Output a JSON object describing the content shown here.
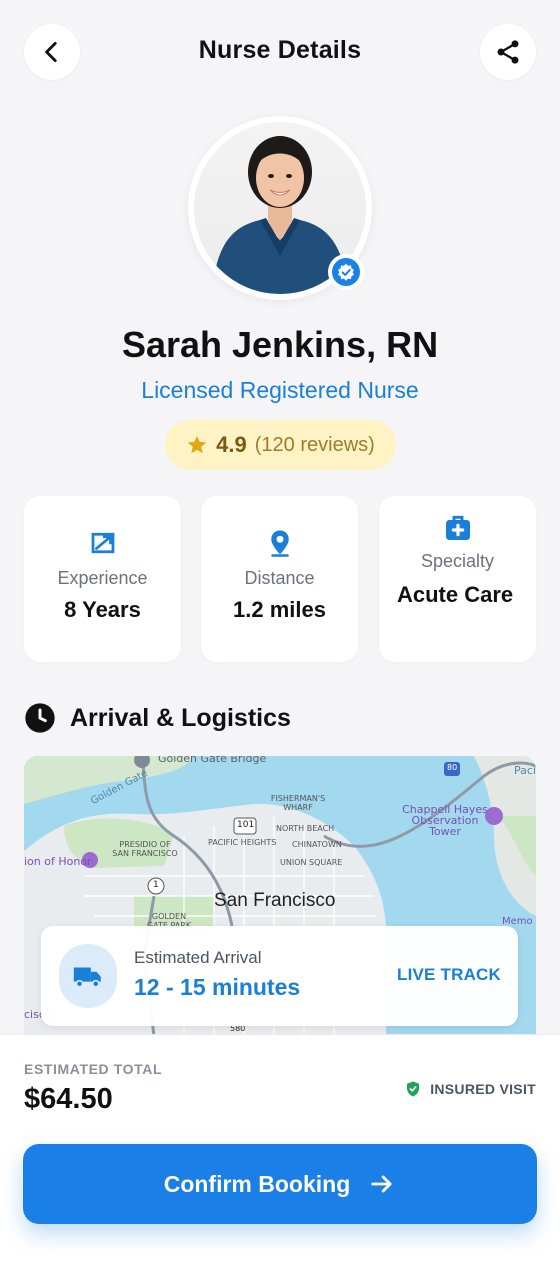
{
  "header": {
    "title": "Nurse Details",
    "back_icon": "chevron-left-icon",
    "share_icon": "share-icon"
  },
  "profile": {
    "name": "Sarah Jenkins, RN",
    "role": "Licensed Registered Nurse",
    "rating": "4.9",
    "reviews": "(120 reviews)",
    "verified_icon": "verified-badge-icon",
    "accent_color": "#1a7fd9",
    "rating_bg": "#fdf3c4"
  },
  "stats": [
    {
      "icon": "experience-icon",
      "label": "Experience",
      "value": "8 Years"
    },
    {
      "icon": "location-pin-icon",
      "label": "Distance",
      "value": "1.2 miles"
    },
    {
      "icon": "medical-kit-icon",
      "label": "Specialty",
      "value": "Acute Care"
    }
  ],
  "logistics": {
    "title": "Arrival & Logistics",
    "map_labels": {
      "city": "San Francisco",
      "golden_gate_bridge": "Golden Gate Bridge",
      "golden_gate": "Golden Gate",
      "fishermans_wharf": "FISHERMAN'S WHARF",
      "north_beach": "NORTH BEACH",
      "presidio": "PRESIDIO OF SAN FRANCISCO",
      "pacific_heights": "PACIFIC HEIGHTS",
      "chinatown": "CHINATOWN",
      "union_square": "UNION SQUARE",
      "chappell_hayes": "Chappell Hayes Observation Tower",
      "legion_of_honor": "ion of Honor",
      "golden_gate_park": "GOLDEN GATE PARK",
      "route_101": "101",
      "route_1": "1",
      "route_80": "80",
      "route_580": "580",
      "pacific": "Paci",
      "memorial": "Memo",
      "cisco": "cisco"
    },
    "eta_label": "Estimated Arrival",
    "eta_value": "12 - 15 minutes",
    "live_track": "LIVE TRACK"
  },
  "footer": {
    "total_label": "ESTIMATED TOTAL",
    "total_value": "$64.50",
    "insured_label": "INSURED VISIT",
    "confirm_label": "Confirm Booking"
  }
}
